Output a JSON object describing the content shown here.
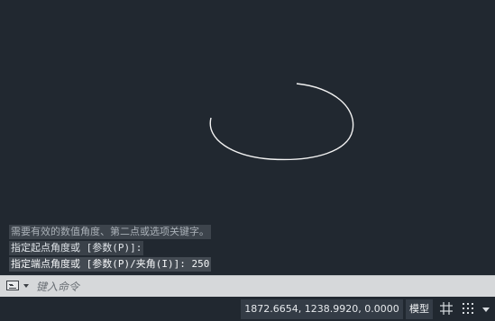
{
  "command_history": [
    "需要有效的数值角度、第二点或选项关键字。",
    "指定起点角度或 [参数(P)]:",
    "指定端点角度或 [参数(P)/夹角(I)]: 250"
  ],
  "command_line": {
    "placeholder": "键入命令",
    "value": ""
  },
  "status_bar": {
    "coordinates": "1872.6654, 1238.9920, 0.0000",
    "model_label": "模型"
  },
  "icons": {
    "command_menu": "command-line-icon",
    "grid": "grid-icon",
    "snap": "snap-mode-icon",
    "customize": "chevron-down-icon"
  },
  "colors": {
    "canvas_background": "#212830",
    "drawn_geometry": "#ffffff"
  }
}
